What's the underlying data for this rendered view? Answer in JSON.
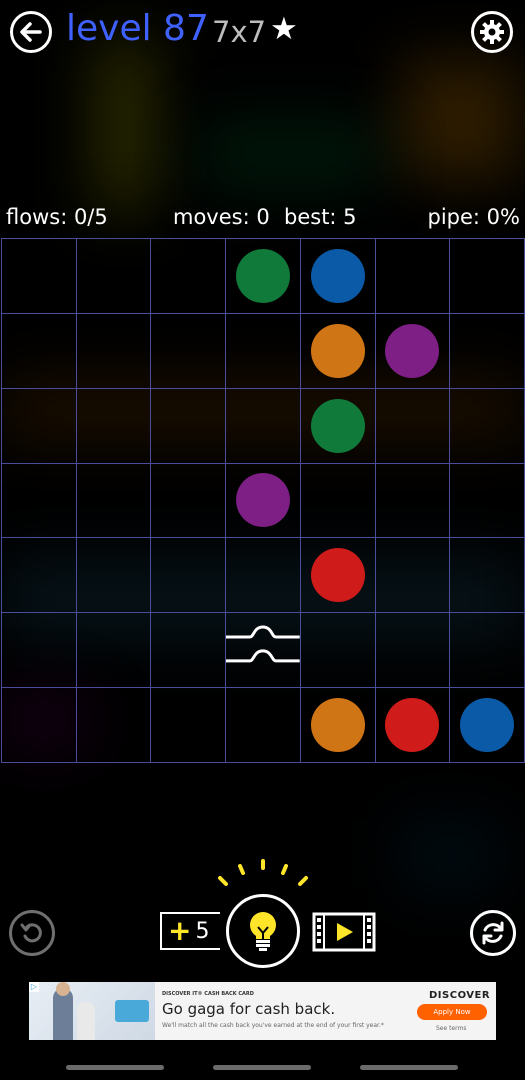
{
  "header": {
    "level_label": "level 87",
    "grid_size": "7x7",
    "star": "★",
    "back_icon": "arrow-left-icon",
    "settings_icon": "gear-icon"
  },
  "stats": {
    "flows": "flows: 0/5",
    "moves": "moves: 0",
    "best": "best: 5",
    "pipe": "pipe: 0%"
  },
  "board": {
    "size": 7,
    "grid_color": "#4a4d9a",
    "colors": {
      "green": "#0f7a3a",
      "blue": "#0b5aa8",
      "orange": "#d07515",
      "purple": "#7e1f86",
      "red": "#d01b1b"
    },
    "dots": [
      {
        "row": 0,
        "col": 3,
        "color": "green"
      },
      {
        "row": 0,
        "col": 4,
        "color": "blue"
      },
      {
        "row": 1,
        "col": 4,
        "color": "orange"
      },
      {
        "row": 1,
        "col": 5,
        "color": "purple"
      },
      {
        "row": 2,
        "col": 4,
        "color": "green"
      },
      {
        "row": 3,
        "col": 3,
        "color": "purple"
      },
      {
        "row": 4,
        "col": 4,
        "color": "red"
      },
      {
        "row": 6,
        "col": 4,
        "color": "orange"
      },
      {
        "row": 6,
        "col": 5,
        "color": "red"
      },
      {
        "row": 6,
        "col": 6,
        "color": "blue"
      }
    ],
    "bridges": [
      {
        "row": 5,
        "col": 3
      }
    ]
  },
  "controls": {
    "hint_plus": "+",
    "hint_count": "5",
    "undo_icon": "undo-icon",
    "hint_icon": "lightbulb-icon",
    "video_icon": "video-play-icon",
    "restart_icon": "restart-icon",
    "hint_accent": "#ffe52a"
  },
  "ad": {
    "eyebrow": "DISCOVER IT® CASH BACK CARD",
    "headline": "Go gaga for cash back.",
    "sub": "We'll match all the cash back you've earned at the end of your first year.*",
    "brand": "DISCOVER",
    "cta": "Apply Now",
    "terms": "See terms",
    "badge": "▷",
    "accent": "#ff6000"
  }
}
